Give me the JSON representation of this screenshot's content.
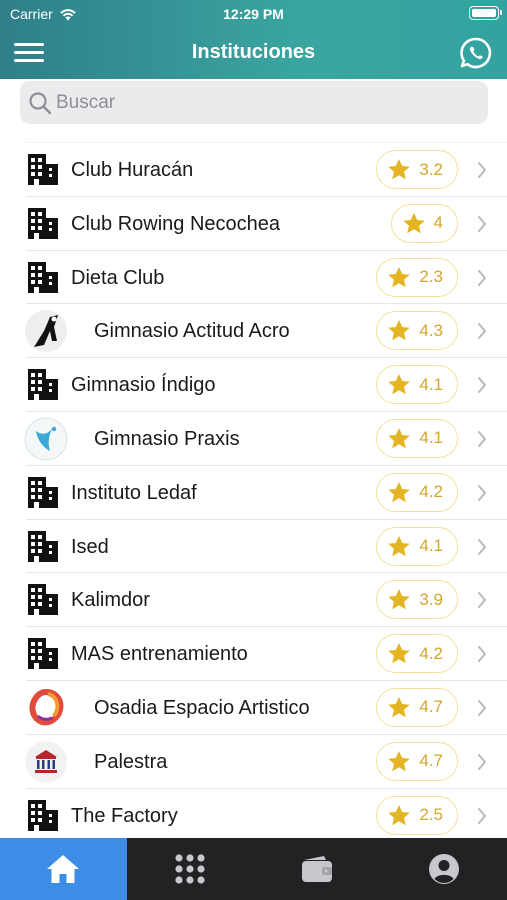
{
  "status_bar": {
    "carrier": "Carrier",
    "time": "12:29 PM"
  },
  "nav": {
    "title": "Instituciones",
    "menu_icon": "hamburger-menu-icon",
    "whatsapp_icon": "whatsapp-icon"
  },
  "search": {
    "placeholder": "Buscar",
    "value": ""
  },
  "accent_color": "#3aa6a0",
  "star_color": "#e5b422",
  "institutions": [
    {
      "name": "Club Huracán",
      "rating": "3.2",
      "icon": "building-icon"
    },
    {
      "name": "Club Rowing Necochea",
      "rating": "4",
      "icon": "building-icon"
    },
    {
      "name": "Dieta Club",
      "rating": "2.3",
      "icon": "building-icon"
    },
    {
      "name": "Gimnasio Actitud Acro",
      "rating": "4.3",
      "icon": "acro-logo"
    },
    {
      "name": "Gimnasio Índigo",
      "rating": "4.1",
      "icon": "building-icon"
    },
    {
      "name": "Gimnasio Praxis",
      "rating": "4.1",
      "icon": "praxis-logo"
    },
    {
      "name": "Instituto Ledaf",
      "rating": "4.2",
      "icon": "building-icon"
    },
    {
      "name": "Ised",
      "rating": "4.1",
      "icon": "building-icon"
    },
    {
      "name": "Kalimdor",
      "rating": "3.9",
      "icon": "building-icon"
    },
    {
      "name": "MAS entrenamiento",
      "rating": "4.2",
      "icon": "building-icon"
    },
    {
      "name": "Osadia Espacio Artistico",
      "rating": "4.7",
      "icon": "osadia-logo"
    },
    {
      "name": "Palestra",
      "rating": "4.7",
      "icon": "palestra-logo"
    },
    {
      "name": "The Factory",
      "rating": "2.5",
      "icon": "building-icon"
    }
  ],
  "tabs": [
    {
      "icon": "home-icon",
      "active": true
    },
    {
      "icon": "grid-icon",
      "active": false
    },
    {
      "icon": "wallet-icon",
      "active": false
    },
    {
      "icon": "profile-icon",
      "active": false
    }
  ]
}
